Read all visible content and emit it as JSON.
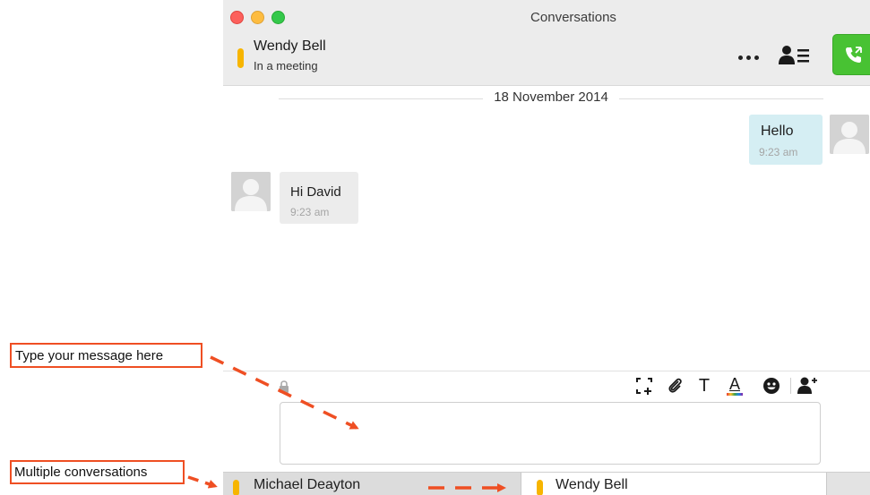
{
  "window": {
    "title": "Conversations"
  },
  "contact": {
    "name": "Wendy Bell",
    "status": "In a meeting",
    "presence_color": "#f7b500"
  },
  "header_actions": {
    "more_icon": "ellipsis-icon",
    "contact_card_icon": "contact-card-icon",
    "call_icon": "phone-icon",
    "call_color": "#48c233"
  },
  "conversation": {
    "date": "18 November 2014",
    "messages": [
      {
        "direction": "outgoing",
        "text": "Hello",
        "time": "9:23 am"
      },
      {
        "direction": "incoming",
        "text": "Hi David",
        "time": "9:23 am"
      }
    ]
  },
  "composer": {
    "lock_icon": "lock-icon",
    "toolbar_icons": [
      "screenshot-icon",
      "paperclip-icon",
      "text-format-icon",
      "font-color-icon",
      "emoji-icon",
      "add-person-icon"
    ],
    "text_icon_glyph": "T",
    "font_color_glyph": "A",
    "input_value": ""
  },
  "tabs": [
    {
      "label": "Michael Deayton",
      "active": false
    },
    {
      "label": "Wendy Bell",
      "active": true
    }
  ],
  "annotations": {
    "type_message": "Type your message here",
    "multiple_conversations": "Multiple conversations",
    "accent_color": "#ef4f23"
  }
}
